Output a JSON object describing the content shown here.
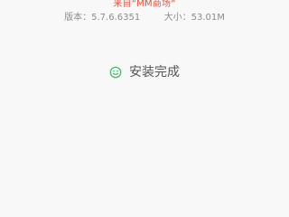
{
  "app_info": {
    "source_label": "来自“MM商场”",
    "version_label": "版本：5.7.6.6351",
    "size_label": "大小：53.01M"
  },
  "install_status": {
    "text": "安装完成",
    "icon": "smile-icon",
    "icon_color": "#3ab56a"
  },
  "theme": {
    "source_color": "#f0523c",
    "meta_color": "#8c8c8c",
    "background": "#f8f8f8"
  }
}
